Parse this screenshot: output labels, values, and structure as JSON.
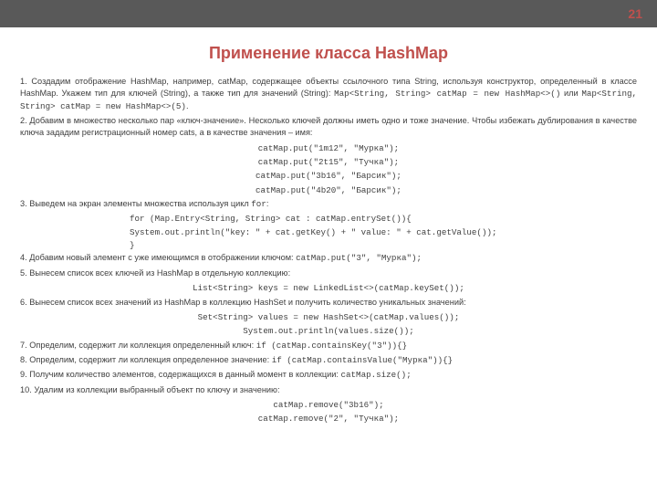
{
  "page_number": "21",
  "title": "Применение класса HashMap",
  "p1_a": "1. Создадим отображение HashMap, например, catMap, содержащее объекты ссылочного типа String, используя конструктор, определенный в классе HashMap. Укажем тип  для ключей  (String), а также тип для  значений (String): ",
  "p1_code1": "Map<String, String> catMap = new HashMap<>()",
  "p1_b": " или ",
  "p1_code2": "Map<String, String> catMap = new HashMap<>(5)",
  "p1_c": ".",
  "p2": "2. Добавим в множество несколько пар «ключ-значение». Несколько ключей должны иметь одно и тоже значение. Чтобы избежать дублирования в качестве ключа зададим регистрационный номер cats, а в качестве значения – имя:",
  "p2_code1": "catMap.put(\"1m12\", \"Мурка\");",
  "p2_code2": "catMap.put(\"2t15\", \"Тучка\");",
  "p2_code3": "catMap.put(\"3b16\", \"Барсик\");",
  "p2_code4": "catMap.put(\"4b20\", \"Барсик\");",
  "p3_a": "3. Выведем на экран элементы множества используя цикл ",
  "p3_for": "for",
  "p3_b": ":",
  "p3_code1": "for (Map.Entry<String, String> cat : catMap.entrySet()){",
  "p3_code2": "System.out.println(\"key: \" + cat.getKey() + \" value: \" + cat.getValue());",
  "p3_code3": "}",
  "p4_a": "4. Добавим новый элемент с уже имеющимся в отображении ключом: ",
  "p4_code": "catMap.put(\"3\", \"Мурка\");",
  "p5": "5. Вынесем  cписок всех ключей  из HashMap в отдельную коллекцию:",
  "p5_code": "List<String> keys = new LinkedList<>(catMap.keySet());",
  "p6": "6. Вынесем  список всех значений  из HashMap в коллекцию HashSet и получить количество уникальных значений:",
  "p6_code1": "Set<String> values = new HashSet<>(catMap.values());",
  "p6_code2": "System.out.println(values.size());",
  "p7_a": "7. Определим, содержит ли коллекция определенный ключ: ",
  "p7_code": "if (catMap.containsKey(\"3\")){}",
  "p8_a": "8. Определим, содержит ли коллекция определенное значение: ",
  "p8_code": "if (catMap.containsValue(\"Мурка\")){}",
  "p9_a": "9. Получим количество элементов, содержащихся в данный момент в коллекции: ",
  "p9_code": "catMap.size();",
  "p10": "10. Удалим из коллекции выбранный объект по ключу и значению:",
  "p10_code1": "catMap.remove(\"3b16\");",
  "p10_code2": "catMap.remove(\"2\", \"Тучка\");"
}
